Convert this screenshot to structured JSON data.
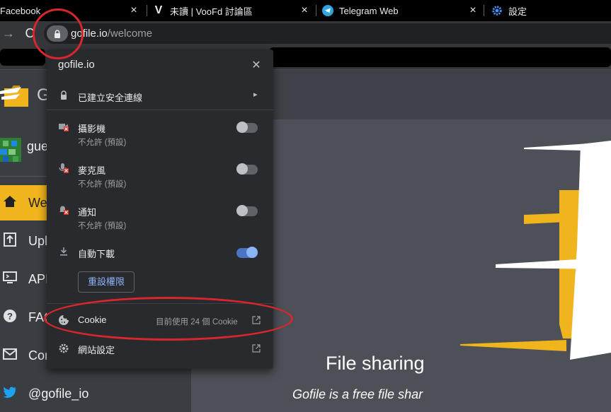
{
  "tabs": [
    {
      "title": "Facebook"
    },
    {
      "title": "未讀 | VooFd 討論區"
    },
    {
      "title": "Telegram Web"
    },
    {
      "title": "設定"
    }
  ],
  "toolbar": {
    "url_host": "gofile.io",
    "url_path": "/welcome"
  },
  "popup": {
    "site": "gofile.io",
    "connection_label": "已建立安全連線",
    "permissions": [
      {
        "label": "攝影機",
        "sub": "不允許 (預設)",
        "enabled": false
      },
      {
        "label": "麥克風",
        "sub": "不允許 (預設)",
        "enabled": false
      },
      {
        "label": "通知",
        "sub": "不允許 (預設)",
        "enabled": false
      },
      {
        "label": "自動下載",
        "sub": "",
        "enabled": true
      }
    ],
    "reset_button": "重設權限",
    "cookie_label": "Cookie",
    "cookie_status": "目前使用 24 個 Cookie",
    "site_settings": "網站設定"
  },
  "sidebar": {
    "logo_letter": "G",
    "user": "gue",
    "items": [
      {
        "label": "Welc",
        "icon": "home-icon"
      },
      {
        "label": "Uplo",
        "icon": "upload-icon"
      },
      {
        "label": "API",
        "icon": "api-icon"
      },
      {
        "label": "FAQ",
        "icon": "question-icon"
      },
      {
        "label": "Cont",
        "icon": "mail-icon"
      },
      {
        "label": "@gofile_io",
        "icon": "twitter-icon"
      }
    ]
  },
  "hero": {
    "title": "File sharing",
    "subtitle": "Gofile is a free file shar"
  },
  "colors": {
    "accent_yellow": "#f0b41c",
    "toggle_on": "#8ab4f8",
    "annotation_red": "#d8262c"
  }
}
